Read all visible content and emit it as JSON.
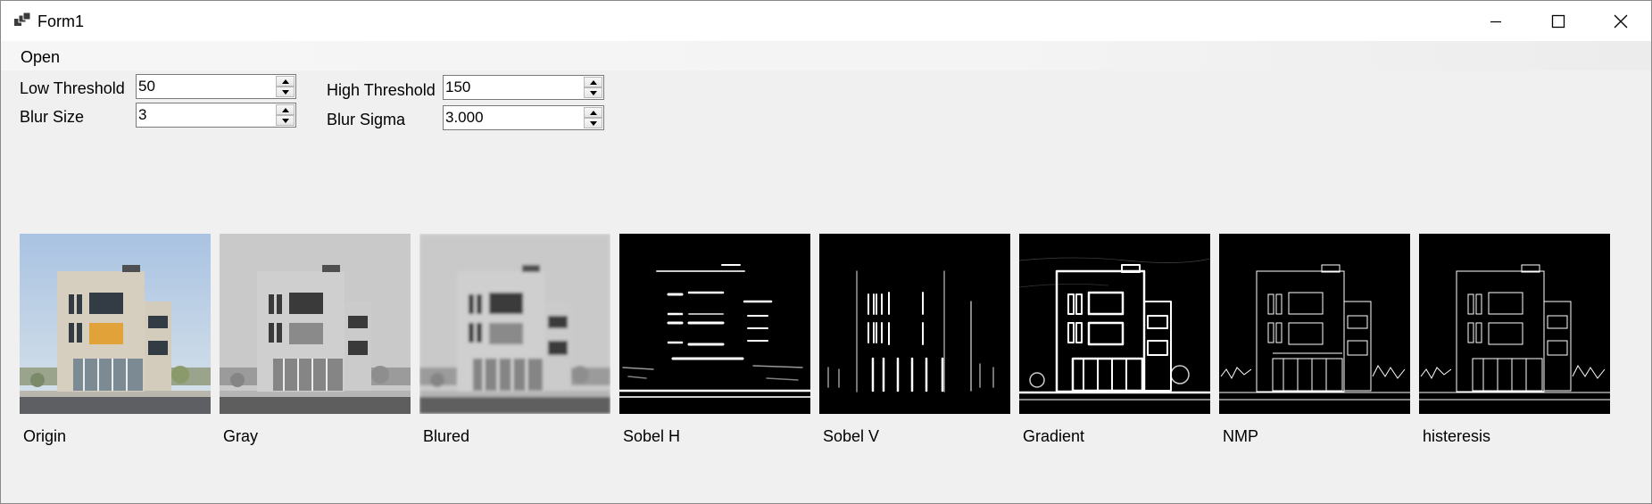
{
  "window": {
    "title": "Form1",
    "controls": {
      "minimize": "minimize-icon",
      "maximize": "maximize-icon",
      "close": "close-icon"
    }
  },
  "menu": {
    "open_label": "Open"
  },
  "params": {
    "low_threshold": {
      "label": "Low Threshold",
      "value": "50"
    },
    "high_threshold": {
      "label": "High Threshold",
      "value": "150"
    },
    "blur_size": {
      "label": "Blur Size",
      "value": "3"
    },
    "blur_sigma": {
      "label": "Blur Sigma",
      "value": "3.000"
    }
  },
  "images": [
    {
      "caption": "Origin"
    },
    {
      "caption": "Gray"
    },
    {
      "caption": "Blured"
    },
    {
      "caption": "Sobel H"
    },
    {
      "caption": "Sobel V"
    },
    {
      "caption": "Gradient"
    },
    {
      "caption": "NMP"
    },
    {
      "caption": "histeresis"
    }
  ],
  "colors": {
    "titlebar": "#ffffff",
    "form_bg": "#f0f0f0",
    "sky": "#b8cfe6",
    "facade": "#d8d1c2"
  }
}
